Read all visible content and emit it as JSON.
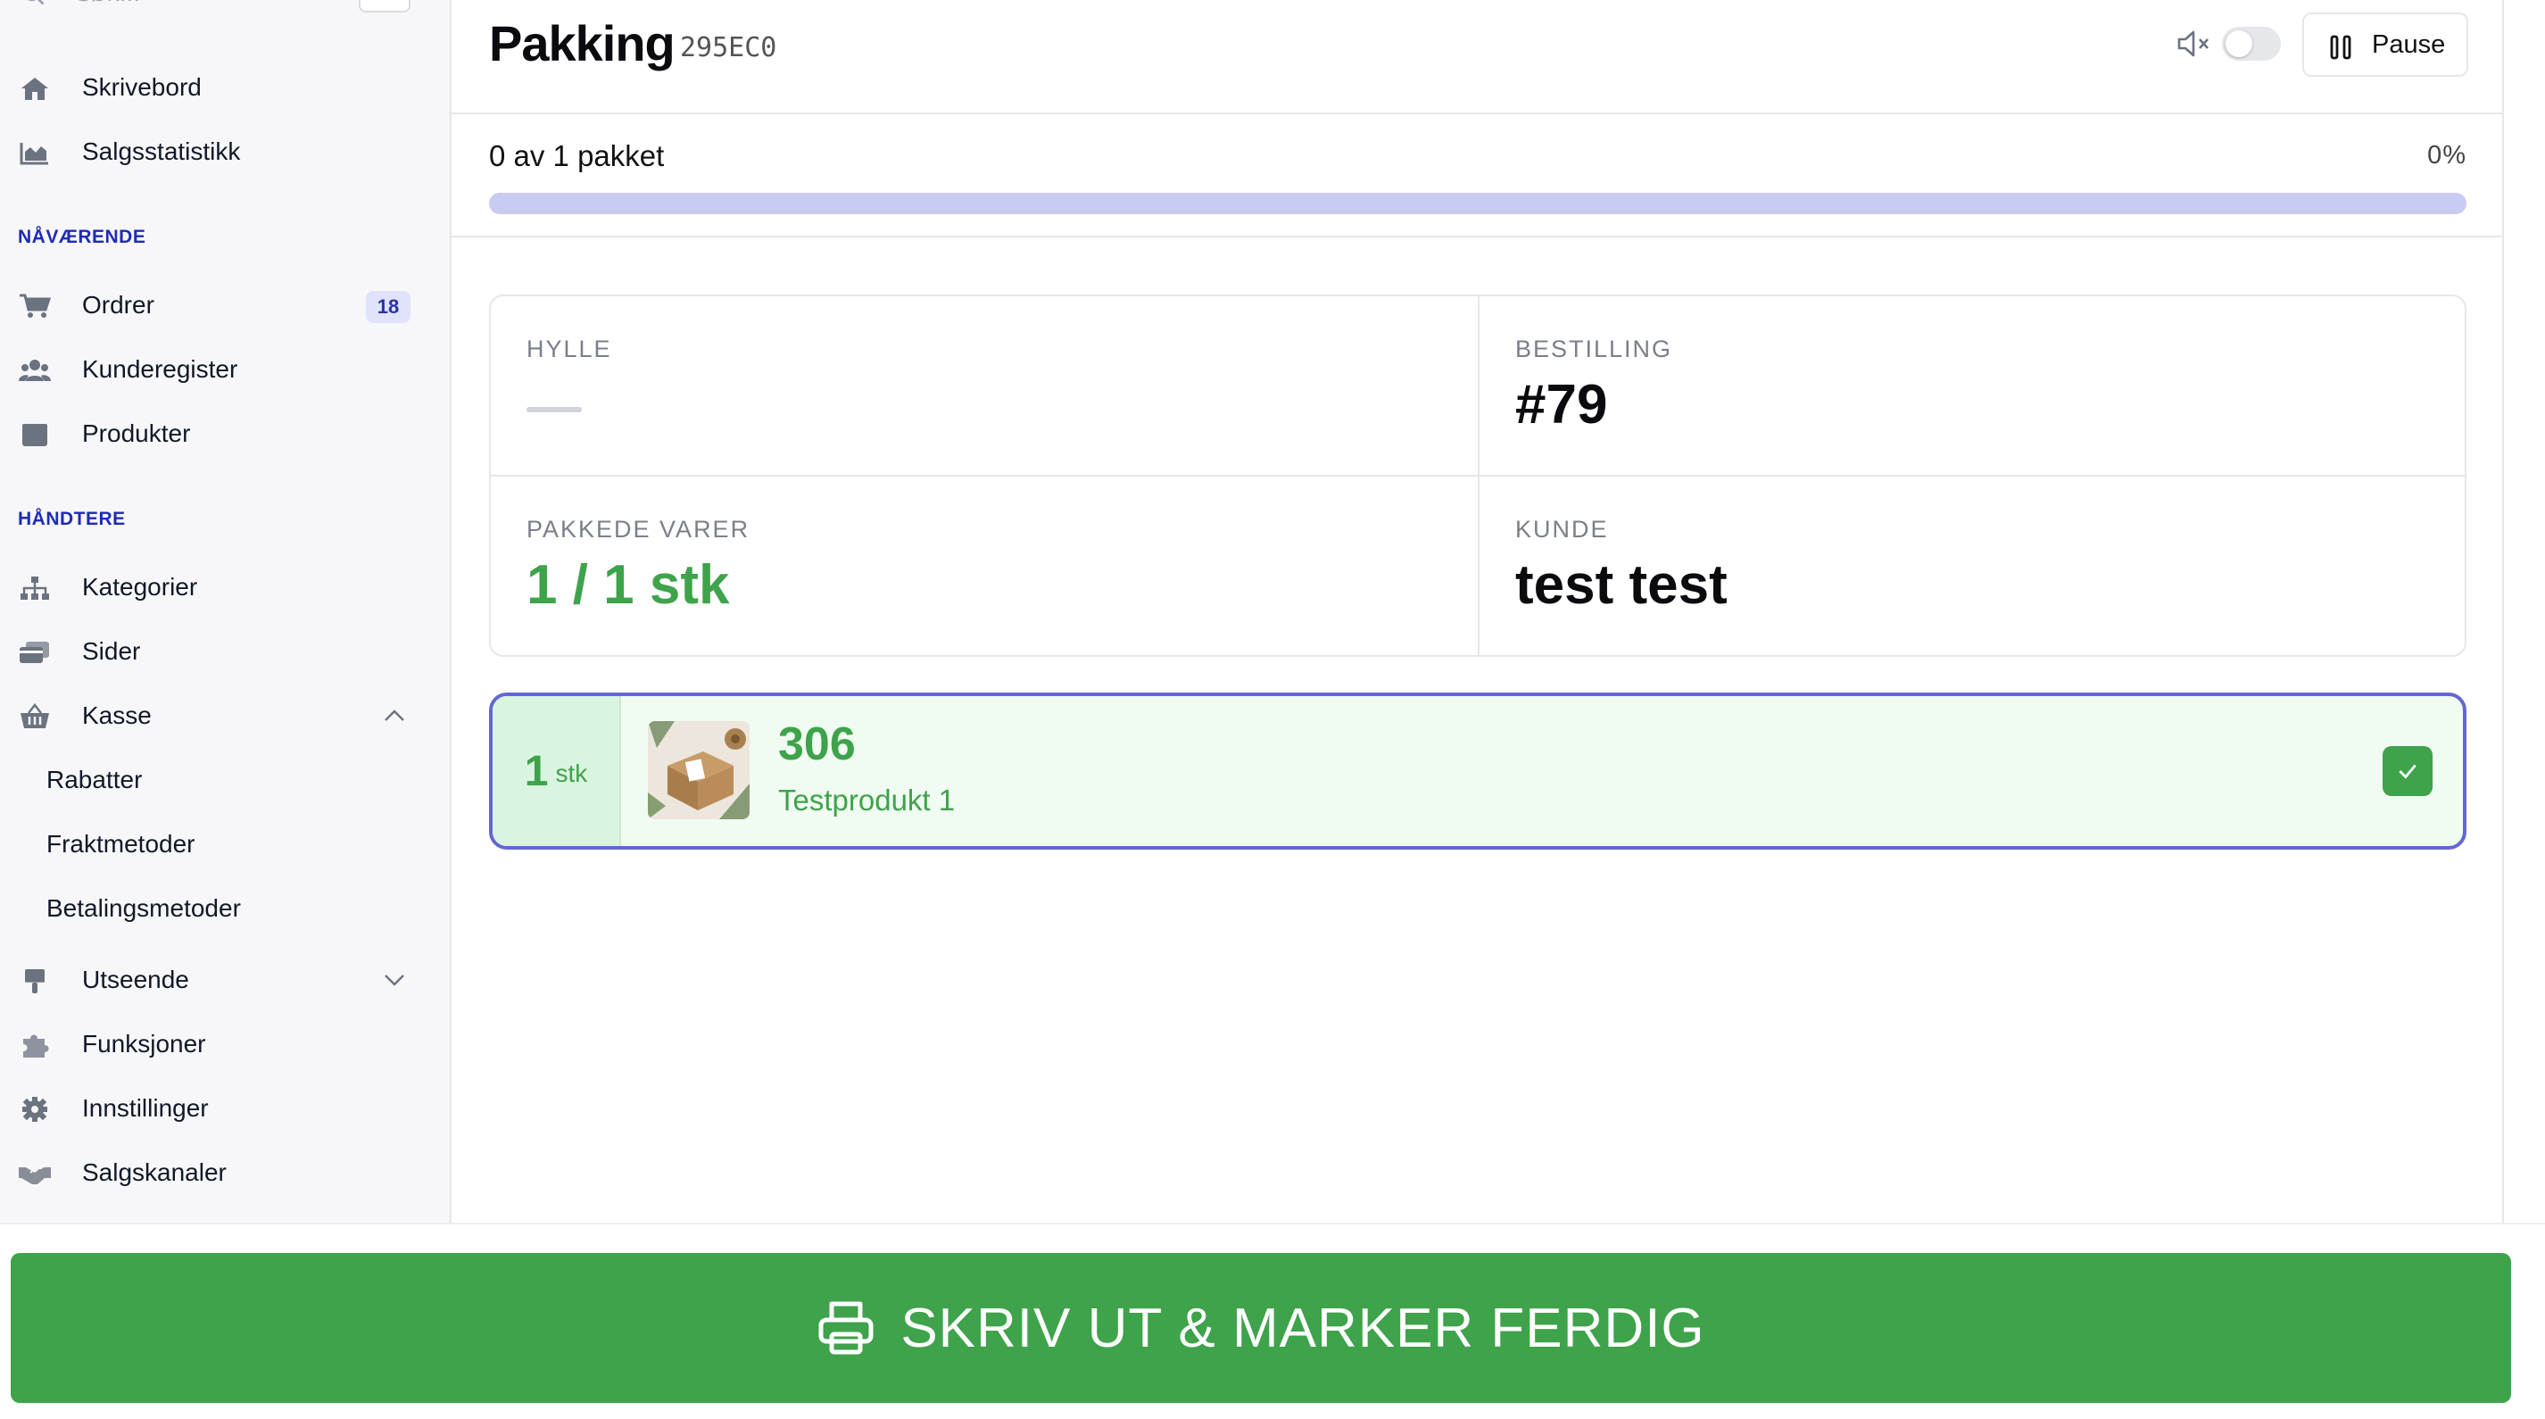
{
  "sidebar": {
    "search_placeholder": "Søk...",
    "items_top": [
      {
        "label": "Skrivebord",
        "icon": "home-icon"
      },
      {
        "label": "Salgsstatistikk",
        "icon": "area-chart-icon"
      }
    ],
    "section_current": "NÅVÆRENDE",
    "items_current": [
      {
        "label": "Ordrer",
        "icon": "cart-icon",
        "badge": "18"
      },
      {
        "label": "Kunderegister",
        "icon": "users-icon"
      },
      {
        "label": "Produkter",
        "icon": "box-icon"
      }
    ],
    "section_manage": "HÅNDTERE",
    "items_manage": [
      {
        "label": "Kategorier",
        "icon": "sitemap-icon"
      },
      {
        "label": "Sider",
        "icon": "pages-icon"
      },
      {
        "label": "Kasse",
        "icon": "basket-icon"
      }
    ],
    "kasse_sub": [
      "Rabatter",
      "Fraktmetoder",
      "Betalingsmetoder"
    ],
    "items_bottom": [
      {
        "label": "Utseende",
        "icon": "paintbrush-icon"
      },
      {
        "label": "Funksjoner",
        "icon": "puzzle-icon"
      },
      {
        "label": "Innstillinger",
        "icon": "gear-icon"
      },
      {
        "label": "Salgskanaler",
        "icon": "handshake-icon"
      }
    ]
  },
  "header": {
    "title": "Pakking",
    "code": "295EC0",
    "pause_label": "Pause"
  },
  "progress": {
    "text": "0 av 1 pakket",
    "percent_text": "0%",
    "fraction": 0
  },
  "info": {
    "shelf_label": "HYLLE",
    "order_label": "BESTILLING",
    "order_value": "#79",
    "packed_label": "PAKKEDE VARER",
    "packed_value": "1 / 1 stk",
    "customer_label": "KUNDE",
    "customer_value": "test test"
  },
  "item": {
    "qty": "1",
    "unit": "stk",
    "sku": "306",
    "name": "Testprodukt 1"
  },
  "footer": {
    "print_label": "SKRIV UT & MARKER FERDIG"
  },
  "colors": {
    "accent": "#3ea34a",
    "brand": "#1f2bb5",
    "progress_track": "#c8cbf2",
    "item_border": "#6366d4"
  }
}
